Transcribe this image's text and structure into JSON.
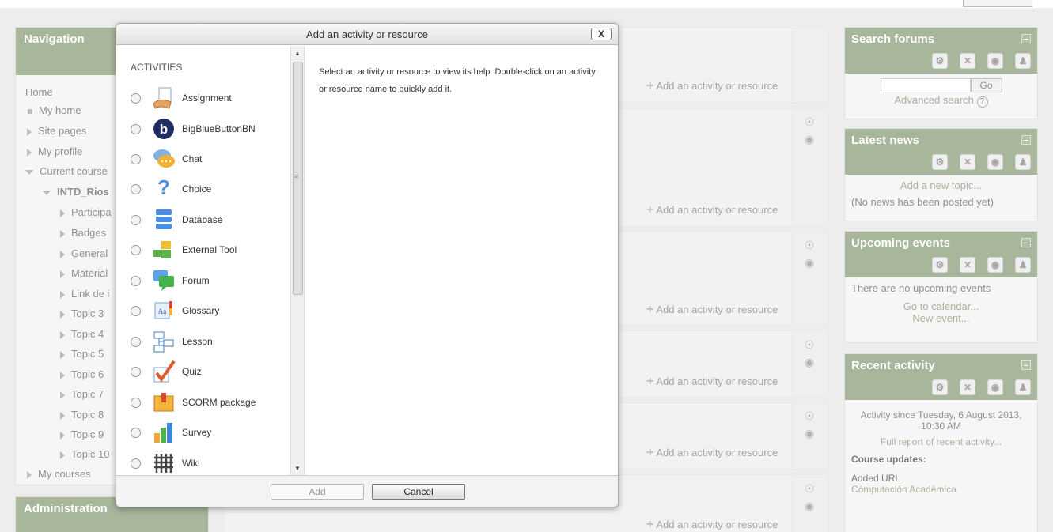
{
  "navigation": {
    "title": "Navigation",
    "home": "Home",
    "items": [
      {
        "label": "My home",
        "kind": "bullet"
      },
      {
        "label": "Site pages",
        "kind": "collapsed"
      },
      {
        "label": "My profile",
        "kind": "collapsed"
      },
      {
        "label": "Current course",
        "kind": "expanded"
      },
      {
        "label": "INTD_Rios",
        "kind": "expanded-bold"
      },
      {
        "label": "Participa",
        "kind": "collapsed"
      },
      {
        "label": "Badges",
        "kind": "collapsed"
      },
      {
        "label": "General",
        "kind": "collapsed"
      },
      {
        "label": "Material",
        "kind": "collapsed"
      },
      {
        "label": "Link de i",
        "kind": "collapsed"
      },
      {
        "label": "Topic 3",
        "kind": "collapsed"
      },
      {
        "label": "Topic 4",
        "kind": "collapsed"
      },
      {
        "label": "Topic 5",
        "kind": "collapsed"
      },
      {
        "label": "Topic 6",
        "kind": "collapsed"
      },
      {
        "label": "Topic 7",
        "kind": "collapsed"
      },
      {
        "label": "Topic 8",
        "kind": "collapsed"
      },
      {
        "label": "Topic 9",
        "kind": "collapsed"
      },
      {
        "label": "Topic 10",
        "kind": "collapsed"
      },
      {
        "label": "My courses",
        "kind": "collapsed"
      }
    ]
  },
  "administration": {
    "title": "Administration"
  },
  "course": {
    "add_activity_label": "Add an activity or resource"
  },
  "search_forums": {
    "title": "Search forums",
    "go_label": "Go",
    "advanced_search": "Advanced search"
  },
  "latest_news": {
    "title": "Latest news",
    "add_topic": "Add a new topic...",
    "empty": "(No news has been posted yet)"
  },
  "upcoming_events": {
    "title": "Upcoming events",
    "empty": "There are no upcoming events",
    "calendar_link": "Go to calendar...",
    "new_event": "New event..."
  },
  "recent_activity": {
    "title": "Recent activity",
    "since": "Activity since Tuesday, 6 August 2013, 10:30 AM",
    "full_report": "Full report of recent activity...",
    "updates_heading": "Course updates:",
    "added": "Added URL",
    "added_item": "Cómputación Académica"
  },
  "dialog": {
    "title": "Add an activity or resource",
    "close_label": "X",
    "category": "ACTIVITIES",
    "help_text": "Select an activity or resource to view its help. Double-click on an activity or resource name to quickly add it.",
    "add_label": "Add",
    "cancel_label": "Cancel",
    "activities": [
      {
        "label": "Assignment",
        "icon": "assignment-icon"
      },
      {
        "label": "BigBlueButtonBN",
        "icon": "bigbluebutton-icon"
      },
      {
        "label": "Chat",
        "icon": "chat-icon"
      },
      {
        "label": "Choice",
        "icon": "choice-icon"
      },
      {
        "label": "Database",
        "icon": "database-icon"
      },
      {
        "label": "External Tool",
        "icon": "external-tool-icon"
      },
      {
        "label": "Forum",
        "icon": "forum-icon"
      },
      {
        "label": "Glossary",
        "icon": "glossary-icon"
      },
      {
        "label": "Lesson",
        "icon": "lesson-icon"
      },
      {
        "label": "Quiz",
        "icon": "quiz-icon"
      },
      {
        "label": "SCORM package",
        "icon": "scorm-icon"
      },
      {
        "label": "Survey",
        "icon": "survey-icon"
      },
      {
        "label": "Wiki",
        "icon": "wiki-icon"
      }
    ]
  },
  "colors": {
    "block_header": "#7a8f68",
    "link": "#7a8a6a"
  }
}
